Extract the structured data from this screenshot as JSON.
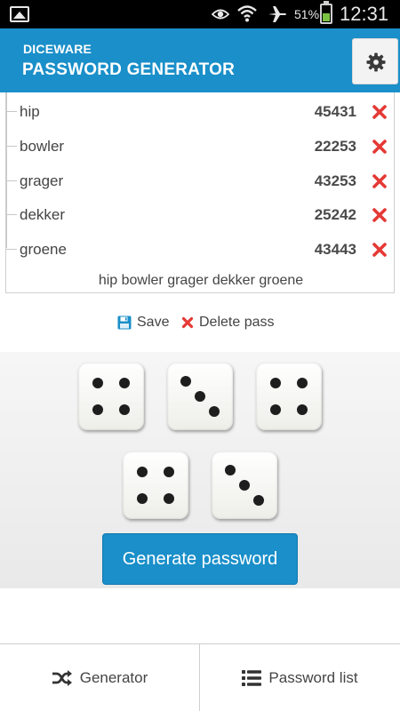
{
  "status_bar": {
    "battery_percent": "51%",
    "time": "12:31"
  },
  "app_bar": {
    "subtitle": "DICEWARE",
    "title": "PASSWORD GENERATOR",
    "settings_icon": "gear-icon"
  },
  "words": [
    {
      "word": "hip",
      "code": "45431"
    },
    {
      "word": "bowler",
      "code": "22253"
    },
    {
      "word": "grager",
      "code": "43253"
    },
    {
      "word": "dekker",
      "code": "25242"
    },
    {
      "word": "groene",
      "code": "43443"
    }
  ],
  "passphrase": "hip bowler grager dekker groene",
  "actions": {
    "save_label": "Save",
    "delete_label": "Delete pass"
  },
  "dice": [
    4,
    3,
    4,
    4,
    3
  ],
  "generate_label": "Generate password",
  "bottom_nav": {
    "generator_label": "Generator",
    "password_list_label": "Password list"
  },
  "colors": {
    "accent": "#1a8fc9",
    "delete_red": "#e53935"
  }
}
